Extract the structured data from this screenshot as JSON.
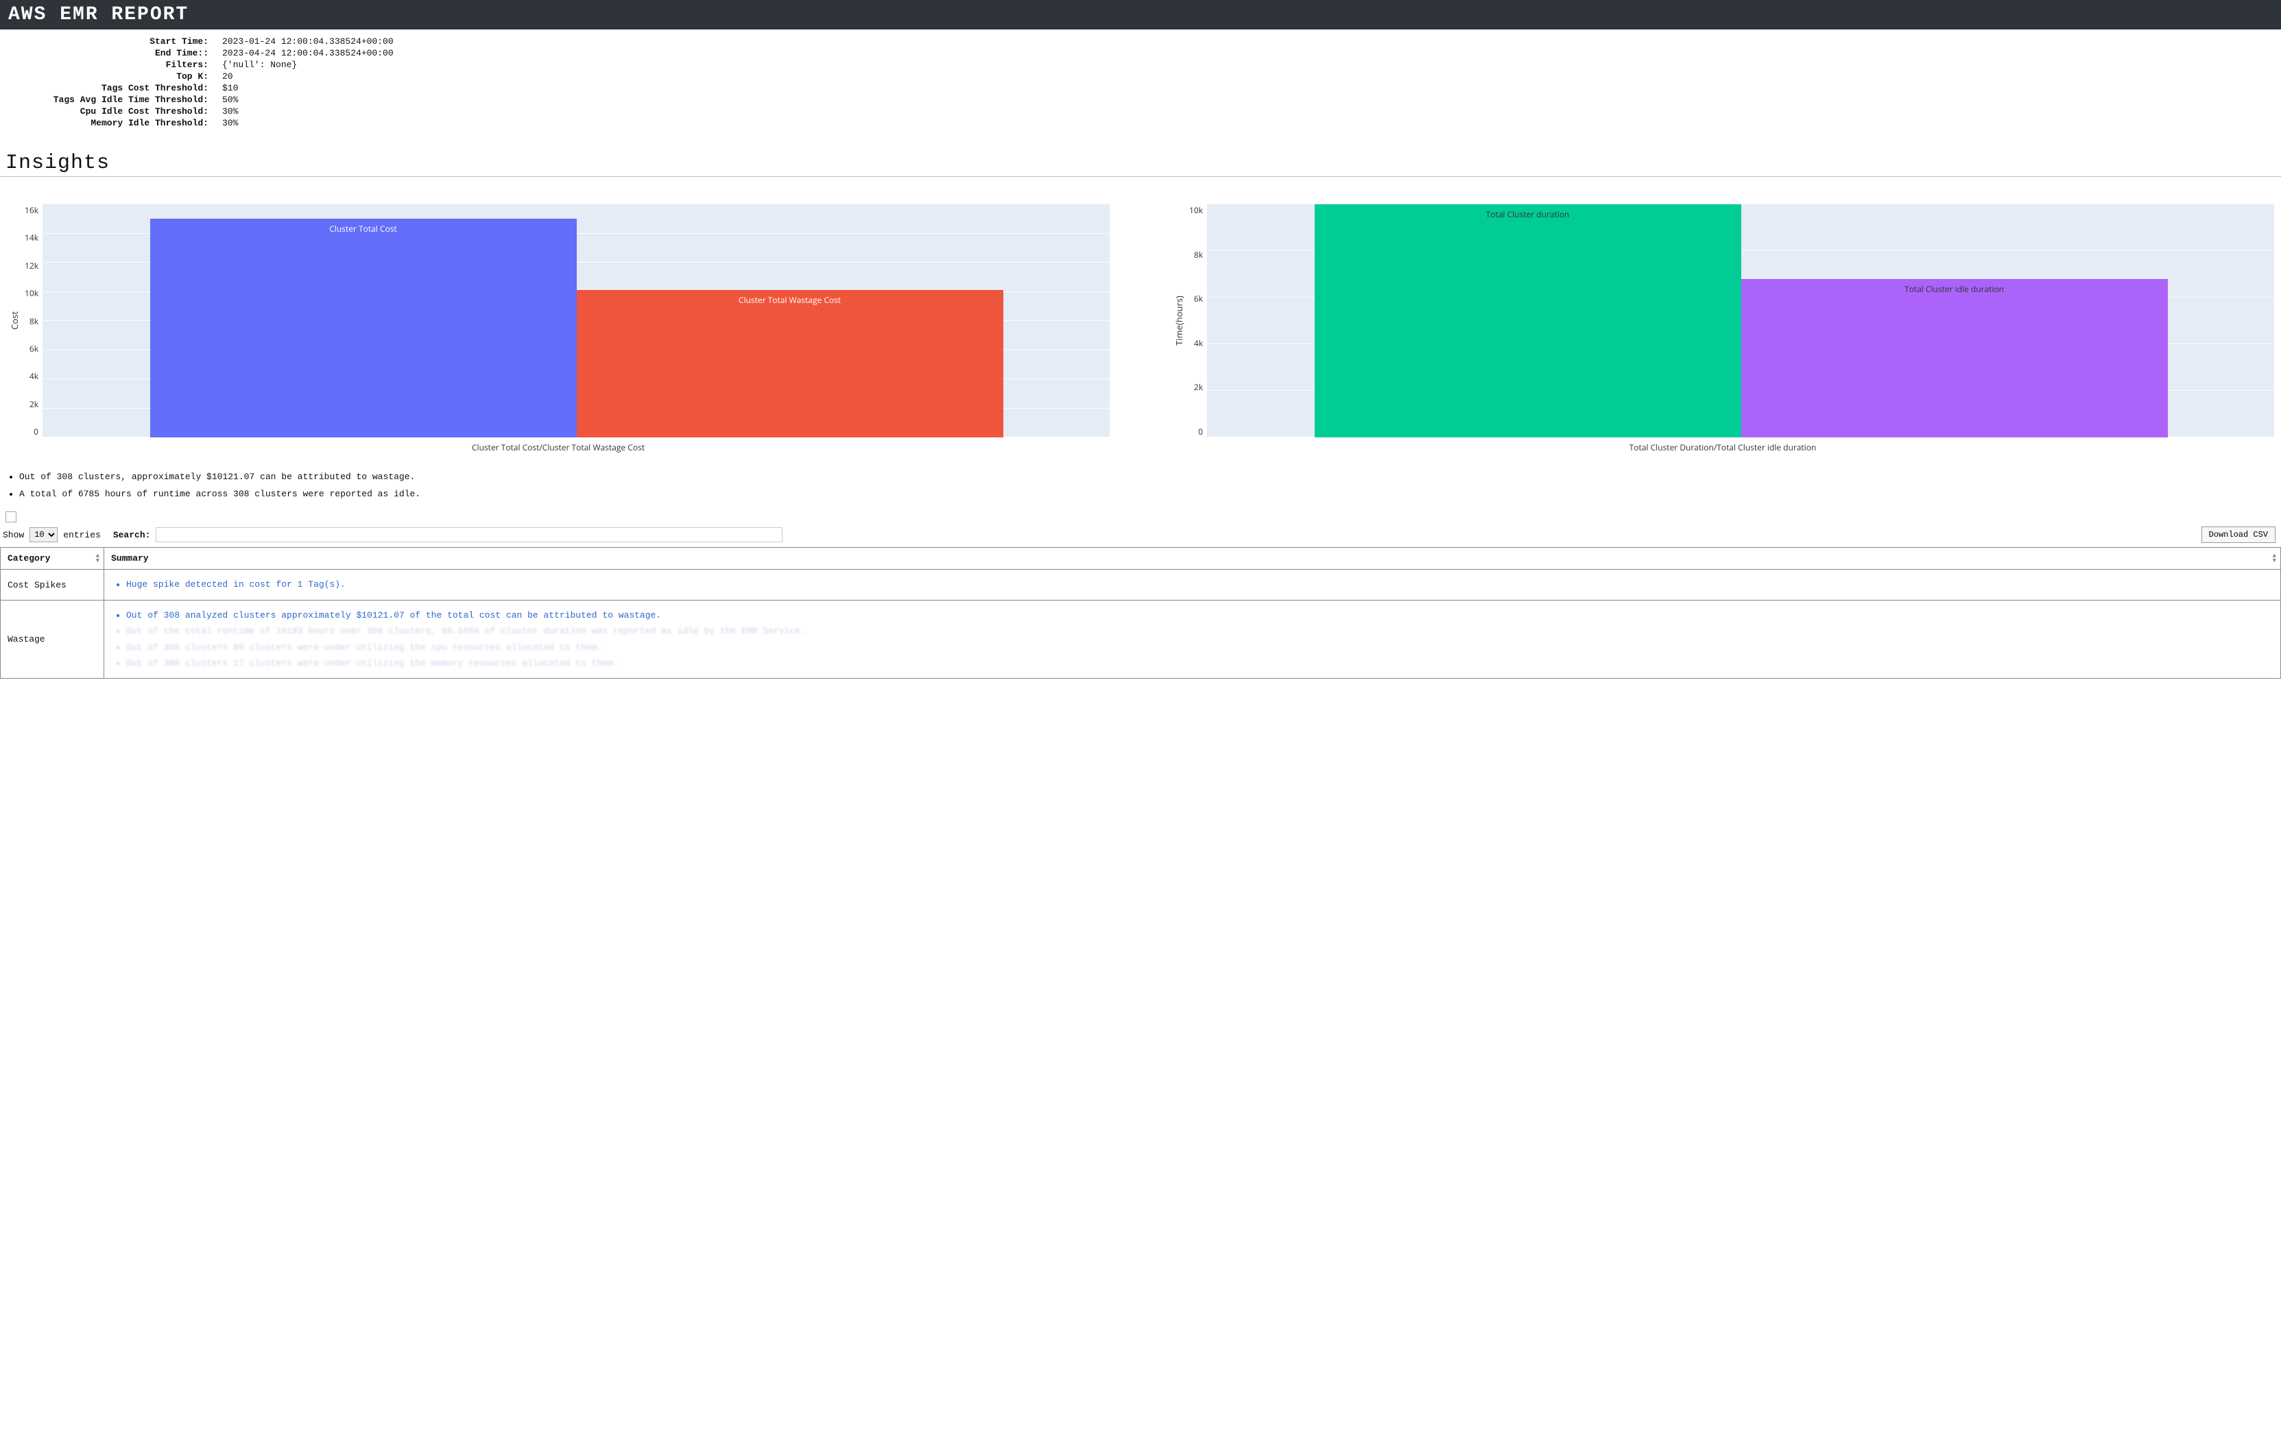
{
  "header": {
    "title": "AWS EMR REPORT"
  },
  "meta": [
    {
      "label": "Start Time:",
      "value": "2023-01-24 12:00:04.338524+00:00"
    },
    {
      "label": "End Time::",
      "value": "2023-04-24 12:00:04.338524+00:00"
    },
    {
      "label": "Filters:",
      "value": "{'null': None}"
    },
    {
      "label": "Top K:",
      "value": "20"
    },
    {
      "label": "Tags Cost Threshold:",
      "value": "$10"
    },
    {
      "label": "Tags Avg Idle Time Threshold:",
      "value": "50%"
    },
    {
      "label": "Cpu Idle Cost Threshold:",
      "value": "30%"
    },
    {
      "label": "Memory Idle Threshold:",
      "value": "30%"
    }
  ],
  "section": {
    "insights_title": "Insights"
  },
  "chart_data": [
    {
      "type": "bar",
      "ylabel": "Cost",
      "xlabel": "Cluster Total Cost/Cluster Total Wastage Cost",
      "ylim": [
        0,
        16000
      ],
      "yticks": [
        "16k",
        "14k",
        "12k",
        "10k",
        "8k",
        "6k",
        "4k",
        "2k",
        "0"
      ],
      "series": [
        {
          "name": "Cluster Total Cost",
          "value": 15000,
          "color": "#636efa",
          "label_color": "light"
        },
        {
          "name": "Cluster Total Wastage Cost",
          "value": 10121,
          "color": "#ef553b",
          "label_color": "light"
        }
      ]
    },
    {
      "type": "bar",
      "ylabel": "Time(hours)",
      "xlabel": "Total Cluster Duration/Total Cluster idle duration",
      "ylim": [
        0,
        10000
      ],
      "yticks": [
        "10k",
        "8k",
        "6k",
        "4k",
        "2k",
        "0"
      ],
      "series": [
        {
          "name": "Total Cluster duration",
          "value": 10183,
          "color": "#00cc96",
          "label_color": "dark"
        },
        {
          "name": "Total Cluster idle duration",
          "value": 6785,
          "color": "#ab63fa",
          "label_color": "dark"
        }
      ]
    }
  ],
  "insights": {
    "bullet1": "Out of 308 clusters, approximately $10121.07 can be attributed to wastage.",
    "bullet2": "A total of 6785 hours of runtime across 308 clusters were reported as idle."
  },
  "controls": {
    "show": "Show",
    "entries": "entries",
    "entries_value": "10",
    "search_label": "Search:",
    "download": "Download CSV"
  },
  "table": {
    "columns": {
      "category": "Category",
      "summary": "Summary"
    },
    "rows": [
      {
        "category": "Cost Spikes",
        "summary": [
          {
            "text": "Huge spike detected in cost for 1 Tag(s).",
            "blurred": false
          }
        ]
      },
      {
        "category": "Wastage",
        "summary": [
          {
            "text": "Out of 308 analyzed clusters approximately $10121.07 of the total cost can be attributed to wastage.",
            "blurred": false
          },
          {
            "text": "Out of the total runtime of 10183 hours over 308 clusters, 66.565% of cluster duration was reported as idle by the EMR Service.",
            "blurred": true
          },
          {
            "text": "Out of 308 clusters 80 clusters were under utilizing the cpu resources allocated to them.",
            "blurred": true
          },
          {
            "text": "Out of 308 clusters 17 clusters were under utilizing the memory resources allocated to them.",
            "blurred": true
          }
        ]
      }
    ]
  }
}
